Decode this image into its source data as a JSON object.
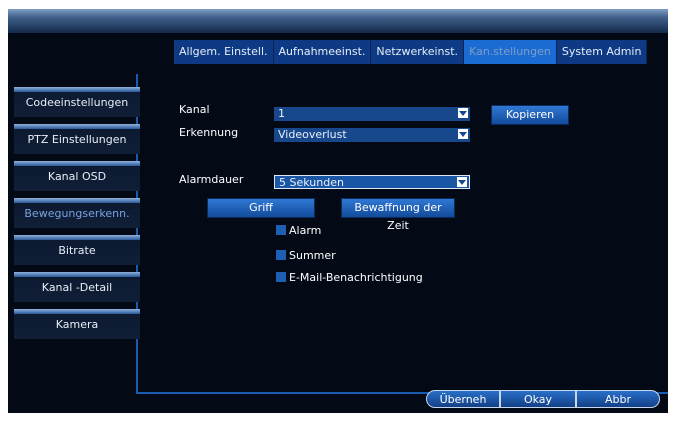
{
  "tabs": [
    {
      "label": "Allgem. Einstell.",
      "active": false
    },
    {
      "label": "Aufnahmeeinst.",
      "active": false
    },
    {
      "label": "Netzwerkeinst.",
      "active": false
    },
    {
      "label": "Kan.stellungen",
      "active": true
    },
    {
      "label": "System Admin",
      "active": false
    }
  ],
  "sidebar": {
    "items": [
      {
        "label": "Codeeinstellungen",
        "active": false
      },
      {
        "label": "PTZ Einstellungen",
        "active": false
      },
      {
        "label": "Kanal OSD",
        "active": false
      },
      {
        "label": "Bewegungserkenn.",
        "active": true
      },
      {
        "label": "Bitrate",
        "active": false
      },
      {
        "label": "Kanal -Detail",
        "active": false
      },
      {
        "label": "Kamera",
        "active": false
      }
    ]
  },
  "form": {
    "kanal_label": "Kanal",
    "kanal_value": "1",
    "copy_button": "Kopieren",
    "erkennung_label": "Erkennung",
    "erkennung_value": "Videoverlust",
    "alarmdauer_label": "Alarmdauer",
    "alarmdauer_value": "5 Sekunden",
    "griff_button": "Griff",
    "bewaffnung_button": "Bewaffnung der Zeit",
    "checkboxes": [
      {
        "label": "Alarm",
        "checked": false
      },
      {
        "label": "Summer",
        "checked": false
      },
      {
        "label": "E-Mail-Benachrichtigung",
        "checked": false
      }
    ]
  },
  "footer": {
    "apply_label": "Überneh",
    "ok_label": "Okay",
    "cancel_label": "Abbr"
  },
  "colors": {
    "background": "#030a16",
    "tab": "#0e3a85",
    "tab_active": "#1b6cd2",
    "accent": "#1a5bb2"
  }
}
